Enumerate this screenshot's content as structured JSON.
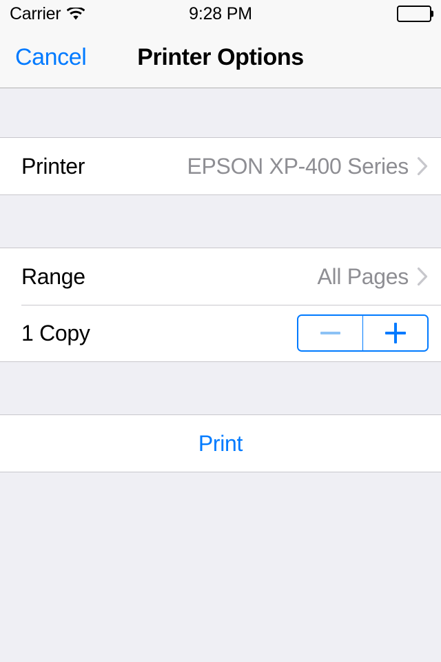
{
  "status_bar": {
    "carrier": "Carrier",
    "wifi_icon": "wifi-icon",
    "time": "9:28 PM",
    "battery_icon": "battery-full-icon"
  },
  "nav_bar": {
    "cancel_label": "Cancel",
    "title": "Printer Options"
  },
  "printer_section": {
    "row": {
      "label": "Printer",
      "value": "EPSON XP-400 Series",
      "disclosure_icon": "chevron-right-icon"
    }
  },
  "options_section": {
    "range_row": {
      "label": "Range",
      "value": "All Pages",
      "disclosure_icon": "chevron-right-icon"
    },
    "copies_row": {
      "label": "1 Copy",
      "count": 1,
      "decrement_glyph": "minus-icon",
      "increment_glyph": "plus-icon",
      "decrement_enabled": false,
      "increment_enabled": true
    }
  },
  "action_section": {
    "print_label": "Print"
  },
  "colors": {
    "tint_blue": "#007AFF",
    "tint_blue_disabled": "#8CC2F5",
    "value_gray": "#8E8E93",
    "chevron_gray": "#C7C7CC",
    "separator": "#C8C7CC",
    "group_background": "#EFEFF4",
    "bar_background": "#F8F8F8",
    "row_background": "#FFFFFF"
  }
}
